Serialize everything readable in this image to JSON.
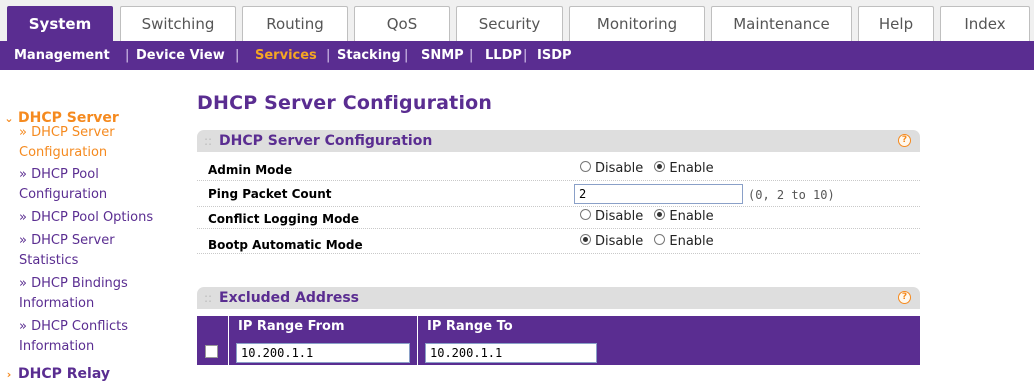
{
  "tabs": [
    {
      "label": "System",
      "active": true
    },
    {
      "label": "Switching",
      "active": false
    },
    {
      "label": "Routing",
      "active": false
    },
    {
      "label": "QoS",
      "active": false
    },
    {
      "label": "Security",
      "active": false
    },
    {
      "label": "Monitoring",
      "active": false
    },
    {
      "label": "Maintenance",
      "active": false
    },
    {
      "label": "Help",
      "active": false
    },
    {
      "label": "Index",
      "active": false
    }
  ],
  "subnav": [
    {
      "label": "Management",
      "active": false
    },
    {
      "label": "Device View",
      "active": false
    },
    {
      "label": "Services",
      "active": true
    },
    {
      "label": "Stacking",
      "active": false
    },
    {
      "label": "SNMP",
      "active": false
    },
    {
      "label": "LLDP",
      "active": false
    },
    {
      "label": "ISDP",
      "active": false
    }
  ],
  "subnav_separator": "|",
  "sidebar": {
    "section_dhcp_server": "DHCP Server",
    "links": [
      {
        "line1": "» DHCP Server",
        "line2": "Configuration",
        "active": true
      },
      {
        "line1": "» DHCP Pool",
        "line2": "Configuration",
        "active": false
      },
      {
        "line1": "» DHCP Pool Options",
        "line2": "",
        "active": false
      },
      {
        "line1": "» DHCP Server",
        "line2": "Statistics",
        "active": false
      },
      {
        "line1": "» DHCP Bindings",
        "line2": "Information",
        "active": false
      },
      {
        "line1": "» DHCP Conflicts",
        "line2": "Information",
        "active": false
      }
    ],
    "section_dhcp_relay": "DHCP Relay"
  },
  "page_title": "DHCP Server Configuration",
  "config_panel": {
    "title": "DHCP Server Configuration",
    "help": "?",
    "rows": {
      "admin_mode": {
        "label": "Admin Mode",
        "options": [
          "Disable",
          "Enable"
        ],
        "selected": "Enable"
      },
      "ping_packet_count": {
        "label": "Ping Packet Count",
        "value": "2",
        "hint": "(0, 2 to 10)"
      },
      "conflict_logging_mode": {
        "label": "Conflict Logging Mode",
        "options": [
          "Disable",
          "Enable"
        ],
        "selected": "Enable"
      },
      "bootp_automatic_mode": {
        "label": "Bootp Automatic Mode",
        "options": [
          "Disable",
          "Enable"
        ],
        "selected": "Disable"
      }
    }
  },
  "excluded_panel": {
    "title": "Excluded Address",
    "help": "?",
    "columns": {
      "from": "IP Range From",
      "to": "IP Range To"
    },
    "row": {
      "from": "10.200.1.1",
      "to": "10.200.1.1"
    }
  },
  "colors": {
    "brand_purple": "#5a2d91",
    "accent_orange": "#f58a1f"
  }
}
